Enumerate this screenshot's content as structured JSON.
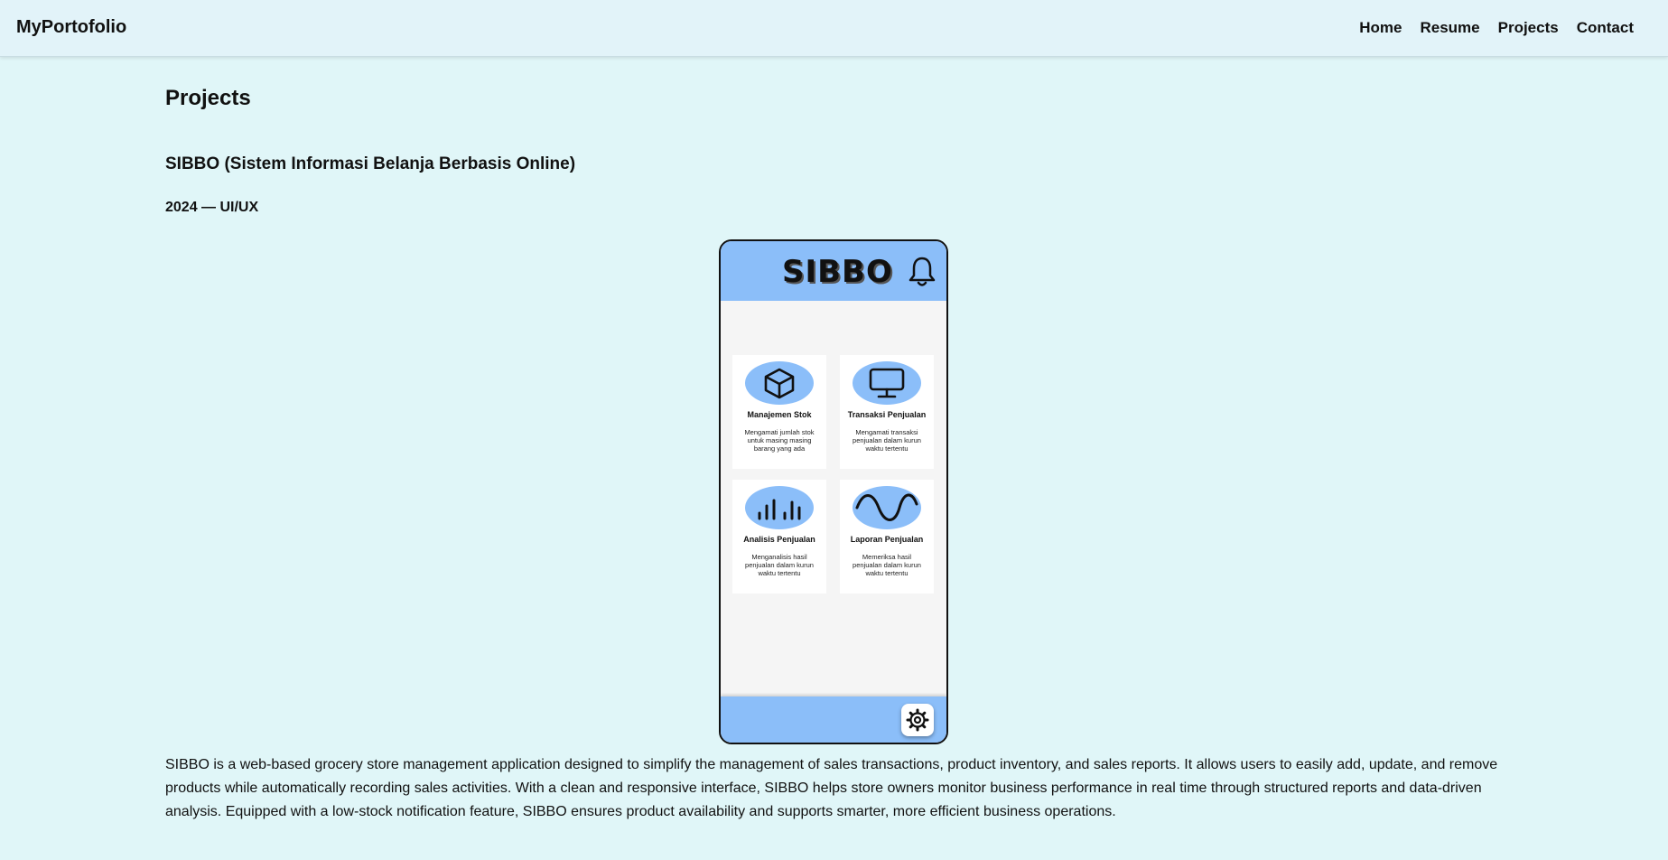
{
  "nav": {
    "brand": "MyPortofolio",
    "links": [
      "Home",
      "Resume",
      "Projects",
      "Contact"
    ]
  },
  "page": {
    "title": "Projects"
  },
  "project": {
    "title": "SIBBO (Sistem Informasi Belanja Berbasis Online)",
    "meta": "2024 — UI/UX",
    "mockup": {
      "logo": "SIBBO",
      "cards": [
        {
          "title": "Manajemen Stok",
          "desc": "Mengamati jumlah stok untuk masing masing barang yang ada",
          "icon": "box-icon"
        },
        {
          "title": "Transaksi Penjualan",
          "desc": "Mengamati transaksi penjualan dalam kurun waktu tertentu",
          "icon": "monitor-icon"
        },
        {
          "title": "Analisis Penjualan",
          "desc": "Menganalisis hasil penjualan dalam kurun waktu tertentu",
          "icon": "bar-chart-icon"
        },
        {
          "title": "Laporan Penjualan",
          "desc": "Memeriksa hasil penjualan dalam kurun waktu tertentu",
          "icon": "wave-icon"
        }
      ],
      "header_icon": "bell-icon",
      "footer_icon": "gear-icon"
    },
    "description": "SIBBO is a web-based grocery store management application designed to simplify the management of sales transactions, product inventory, and sales reports. It allows users to easily add, update, and remove products while automatically recording sales activities. With a clean and responsive interface, SIBBO helps store owners monitor business performance in real time through structured reports and data-driven analysis. Equipped with a low-stock notification feature, SIBBO ensures product availability and supports smarter, more efficient business operations."
  },
  "colors": {
    "page_bg": "#e0f6f8",
    "navbar_bg": "#e2f3f9",
    "mockup_accent": "#8bbef9"
  }
}
